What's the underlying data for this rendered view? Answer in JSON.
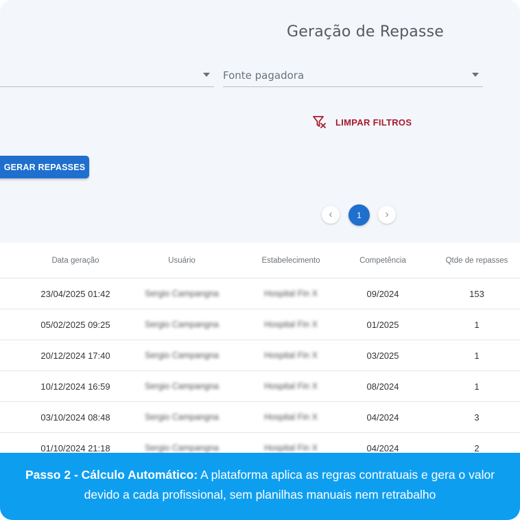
{
  "header": {
    "title": "Geração de Repasse"
  },
  "filters": {
    "first_select_value": "",
    "second_select_value": "Fonte pagadora",
    "clear_label": "LIMPAR FILTROS"
  },
  "actions": {
    "generate_label": "GERAR REPASSES"
  },
  "pagination": {
    "current_page": "1",
    "prev_glyph": "‹",
    "next_glyph": "›"
  },
  "table": {
    "columns": [
      "Data geração",
      "Usuário",
      "Estabelecimento",
      "Competência",
      "Qtde de repasses"
    ],
    "rows": [
      {
        "date": "23/04/2025 01:42",
        "user": "Sergio Campangna",
        "estab": "Hospital Fin X",
        "comp": "09/2024",
        "qtde": "153"
      },
      {
        "date": "05/02/2025 09:25",
        "user": "Sergio Campangna",
        "estab": "Hospital Fin X",
        "comp": "01/2025",
        "qtde": "1"
      },
      {
        "date": "20/12/2024 17:40",
        "user": "Sergio Campangna",
        "estab": "Hospital Fin X",
        "comp": "03/2025",
        "qtde": "1"
      },
      {
        "date": "10/12/2024 16:59",
        "user": "Sergio Campangna",
        "estab": "Hospital Fin X",
        "comp": "08/2024",
        "qtde": "1"
      },
      {
        "date": "03/10/2024 08:48",
        "user": "Sergio Campangna",
        "estab": "Hospital Fin X",
        "comp": "04/2024",
        "qtde": "3"
      },
      {
        "date": "01/10/2024 21:18",
        "user": "Sergio Campangna",
        "estab": "Hospital Fin X",
        "comp": "04/2024",
        "qtde": "2"
      }
    ]
  },
  "banner": {
    "bold": "Passo 2 - Cálculo Automático:",
    "text": " A plataforma aplica as regras contratuais e gera o valor devido a cada profissional, sem planilhas manuais nem retrabalho"
  },
  "colors": {
    "primary": "#1e6fce",
    "danger": "#a8192e",
    "banner": "#0e9ef0"
  }
}
